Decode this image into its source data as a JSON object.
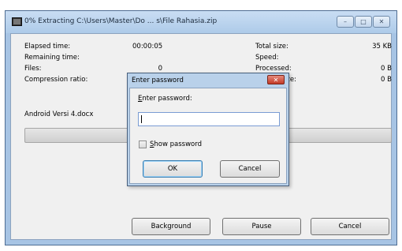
{
  "window": {
    "title": "0% Extracting C:\\Users\\Master\\Do ... s\\File Rahasia.zip",
    "controls": {
      "minimize": "–",
      "maximize": "□",
      "close": "✕"
    }
  },
  "stats": {
    "elapsed_label": "Elapsed time:",
    "elapsed_value": "00:00:05",
    "remaining_label": "Remaining time:",
    "files_label": "Files:",
    "files_value": "0",
    "ratio_label": "Compression ratio:",
    "total_label": "Total size:",
    "total_value": "35 KB",
    "speed_label": "Speed:",
    "processed_label": "Processed:",
    "processed_value": "0 B",
    "packed_label": "Packed size:",
    "packed_value": "0 B"
  },
  "current_file": "Android Versi 4.docx",
  "progress": {
    "percent": 0,
    "fill_color": "#27c13a"
  },
  "buttons": {
    "background": "Background",
    "pause": "Pause",
    "cancel": "Cancel"
  },
  "dialog": {
    "title": "Enter password",
    "close": "✕",
    "prompt_first": "E",
    "prompt_rest": "nter password:",
    "password_value": "",
    "show_first": "S",
    "show_rest": "how password",
    "ok": "OK",
    "cancel": "Cancel"
  }
}
